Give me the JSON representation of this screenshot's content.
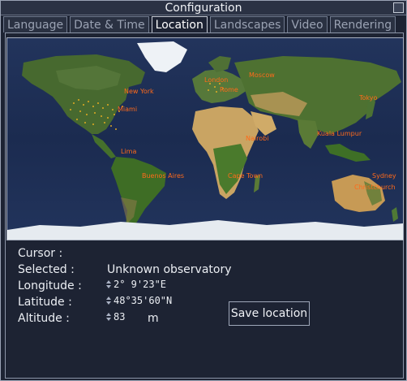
{
  "window": {
    "title": "Configuration"
  },
  "tabs": [
    {
      "label": "Language",
      "active": false
    },
    {
      "label": "Date & Time",
      "active": false
    },
    {
      "label": "Location",
      "active": true
    },
    {
      "label": "Landscapes",
      "active": false
    },
    {
      "label": "Video",
      "active": false
    },
    {
      "label": "Rendering",
      "active": false
    }
  ],
  "map": {
    "cities": [
      {
        "name": "London"
      },
      {
        "name": "Rome"
      },
      {
        "name": "Moscow"
      },
      {
        "name": "New York"
      },
      {
        "name": "Miami"
      },
      {
        "name": "Tokyo"
      },
      {
        "name": "Nairobi"
      },
      {
        "name": "Kuala Lumpur"
      },
      {
        "name": "Lima"
      },
      {
        "name": "Buenos Aires"
      },
      {
        "name": "Cape Town"
      },
      {
        "name": "Sydney"
      },
      {
        "name": "Christchurch"
      }
    ],
    "colors": {
      "ocean": "#1c2d52",
      "land": "#3f6a2a",
      "desert": "#c9a463",
      "ice": "#e8edf2",
      "city_label": "#ff6a1a"
    }
  },
  "info": {
    "cursor_label": "Cursor :",
    "cursor_value": "",
    "selected_label": "Selected :",
    "selected_value": "Unknown observatory",
    "longitude_label": "Longitude :",
    "longitude_value": "2° 9'23\"E",
    "latitude_label": "Latitude :",
    "latitude_value": "48°35'60\"N",
    "altitude_label": "Altitude :",
    "altitude_value": "83",
    "altitude_unit": "m"
  },
  "buttons": {
    "save_location": "Save location"
  },
  "icons": {
    "close": "close-icon",
    "spinner": "spinner-arrows-icon"
  }
}
